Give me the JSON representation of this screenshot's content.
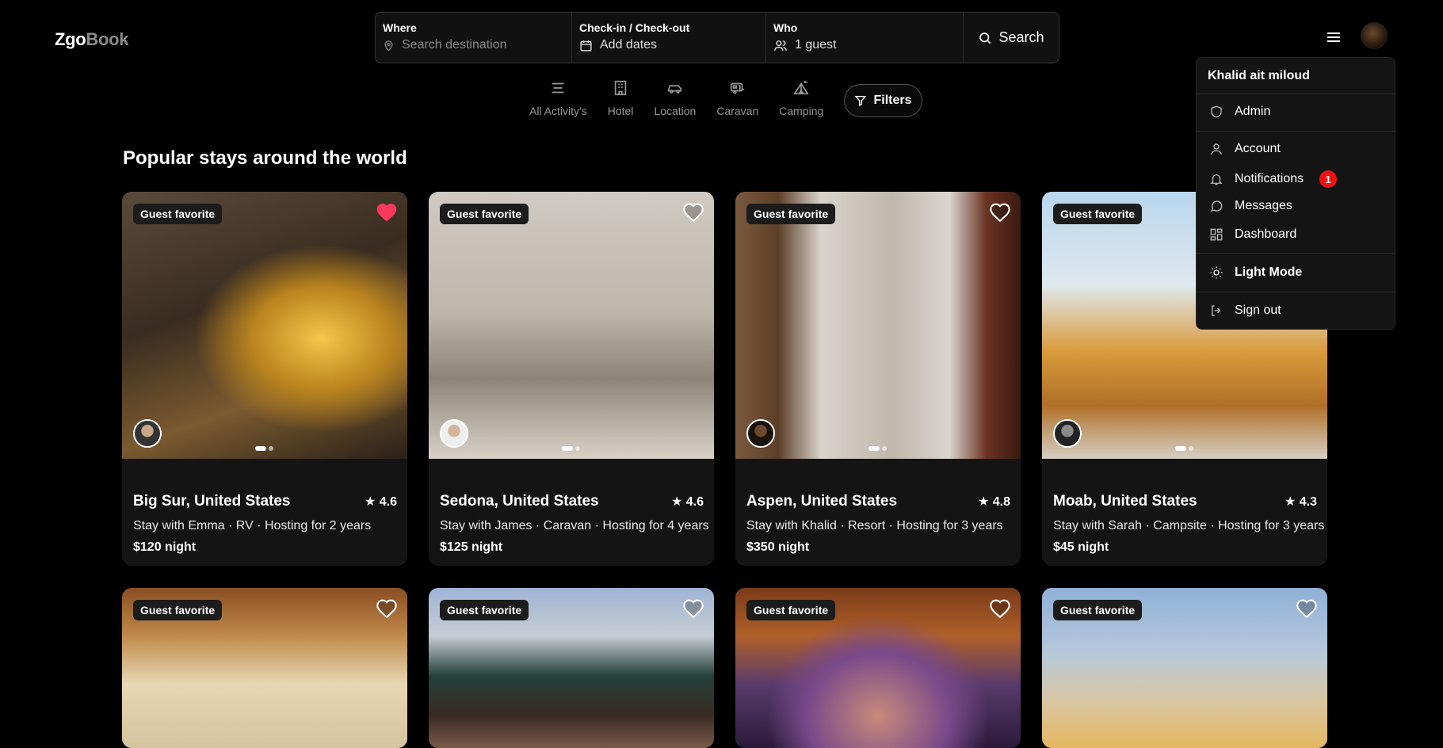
{
  "brand": {
    "logo_part1": "Zgo",
    "logo_part2": "Book"
  },
  "search": {
    "where_label": "Where",
    "where_placeholder": "Search destination",
    "dates_label": "Check-in / Check-out",
    "dates_value": "Add dates",
    "who_label": "Who",
    "who_value": "1 guest",
    "button_label": "Search"
  },
  "categories": [
    {
      "label": "All Activity's",
      "icon": "list-icon"
    },
    {
      "label": "Hotel",
      "icon": "building-icon"
    },
    {
      "label": "Location",
      "icon": "car-icon"
    },
    {
      "label": "Caravan",
      "icon": "caravan-icon"
    },
    {
      "label": "Camping",
      "icon": "tent-icon"
    }
  ],
  "filters_label": "Filters",
  "section_title": "Popular stays around the world",
  "listings": [
    {
      "badge": "Guest favorite",
      "title": "Big Sur, United States",
      "rating": "★ 4.6",
      "subtitle": "Stay with Emma · RV · Hosting for 2 years",
      "price": "$120 night",
      "favorited": true
    },
    {
      "badge": "Guest favorite",
      "title": "Sedona, United States",
      "rating": "★ 4.6",
      "subtitle": "Stay with James · Caravan · Hosting for 4 years",
      "price": "$125 night",
      "favorited": false
    },
    {
      "badge": "Guest favorite",
      "title": "Aspen, United States",
      "rating": "★ 4.8",
      "subtitle": "Stay with Khalid · Resort · Hosting for 3 years",
      "price": "$350 night",
      "favorited": false
    },
    {
      "badge": "Guest favorite",
      "title": "Moab, United States",
      "rating": "★ 4.3",
      "subtitle": "Stay with Sarah · Campsite · Hosting for 3 years",
      "price": "$45 night",
      "favorited": false
    },
    {
      "badge": "Guest favorite"
    },
    {
      "badge": "Guest favorite"
    },
    {
      "badge": "Guest favorite"
    },
    {
      "badge": "Guest favorite"
    }
  ],
  "user_menu": {
    "user_name": "Khalid ait miloud",
    "admin": "Admin",
    "account": "Account",
    "notifications": "Notifications",
    "notifications_count": "1",
    "messages": "Messages",
    "dashboard": "Dashboard",
    "light_mode": "Light Mode",
    "sign_out": "Sign out"
  },
  "colors": {
    "background": "#000000",
    "card": "#141414",
    "heart_active": "#ff385c",
    "notification": "#ee1111"
  }
}
